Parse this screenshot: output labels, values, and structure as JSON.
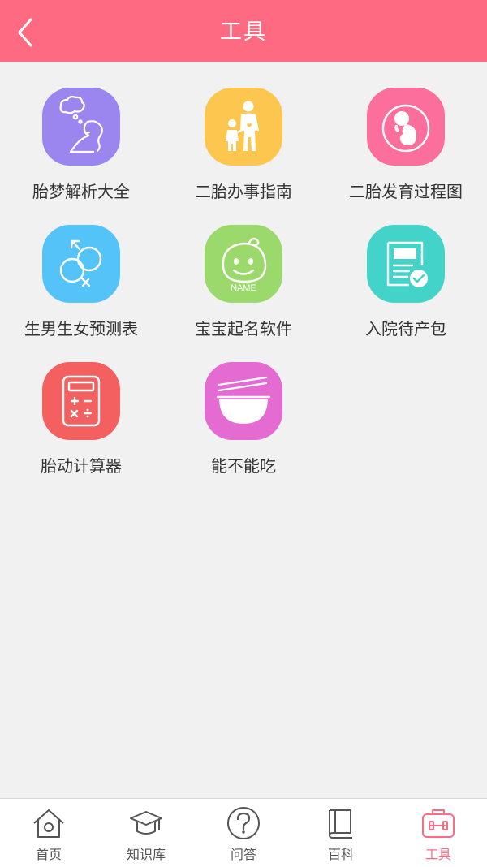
{
  "header": {
    "title": "工具"
  },
  "colors": {
    "accent": "#fd6a82",
    "background": "#f1f1f1",
    "tab_inactive": "#555555"
  },
  "tools": [
    {
      "label": "胎梦解析大全",
      "icon": "dream-icon",
      "color": "#9b86f0"
    },
    {
      "label": "二胎办事指南",
      "icon": "family-icon",
      "color": "#fdc64e"
    },
    {
      "label": "二胎发育过程图",
      "icon": "fetus-icon",
      "color": "#fc6f9d"
    },
    {
      "label": "生男生女预测表",
      "icon": "gender-icon",
      "color": "#54c4f8"
    },
    {
      "label": "宝宝起名软件",
      "icon": "baby-face-icon",
      "color": "#9bd96c",
      "icon_text": "NAME"
    },
    {
      "label": "入院待产包",
      "icon": "checklist-icon",
      "color": "#43d3c8"
    },
    {
      "label": "胎动计算器",
      "icon": "calculator-icon",
      "color": "#f46060"
    },
    {
      "label": "能不能吃",
      "icon": "bowl-icon",
      "color": "#e36bd1"
    }
  ],
  "tabbar": {
    "items": [
      {
        "label": "首页",
        "icon": "home-icon",
        "active": false
      },
      {
        "label": "知识库",
        "icon": "graduation-cap-icon",
        "active": false
      },
      {
        "label": "问答",
        "icon": "question-icon",
        "active": false
      },
      {
        "label": "百科",
        "icon": "book-icon",
        "active": false
      },
      {
        "label": "工具",
        "icon": "toolbox-icon",
        "active": true
      }
    ]
  }
}
